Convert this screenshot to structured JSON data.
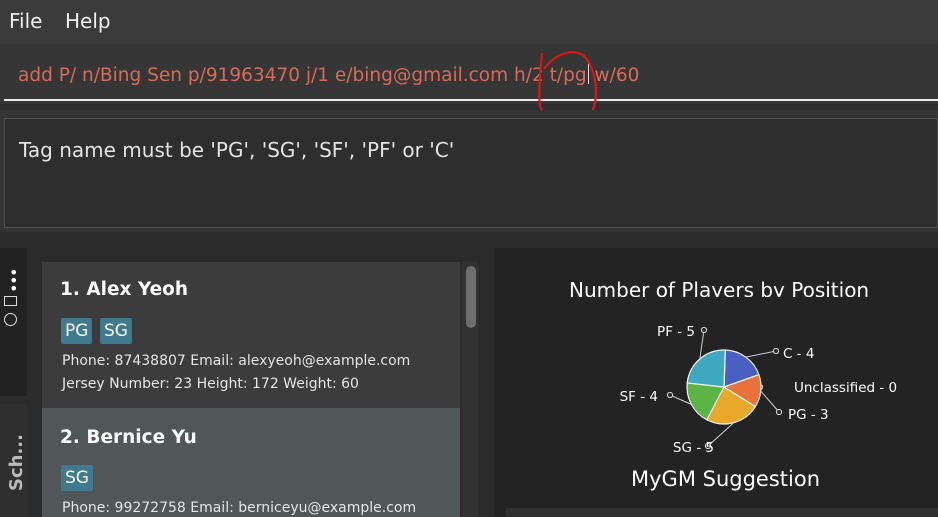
{
  "menu": {
    "file": "File",
    "help": "Help"
  },
  "command": {
    "text": "add P/ n/Bing Sen p/91963470 j/1 e/bing@gmail.com h/2 t/pg",
    "text_after_caret": " w/60"
  },
  "result": {
    "message": "Tag name must be 'PG', 'SG', 'SF', 'PF' or 'C'"
  },
  "sidebar": {
    "tab_label": "Sch..."
  },
  "players": [
    {
      "name": "1.  Alex Yeoh",
      "tags": [
        "PG",
        "SG"
      ],
      "line1": "Phone: 87438807   Email: alexyeoh@example.com",
      "line2": "Jersey Number: 23   Height: 172   Weight: 60"
    },
    {
      "name": "2.  Bernice Yu",
      "tags": [
        "SG"
      ],
      "line1": "Phone: 99272758   Email: berniceyu@example.com"
    }
  ],
  "chart_data": {
    "type": "pie",
    "title": "Number of Players by Position",
    "slices": [
      {
        "label": "C - 4",
        "value": 4,
        "color": "#4a5fc1"
      },
      {
        "label": "Unclassified - 0",
        "value": 0,
        "color": "#e0e0e0"
      },
      {
        "label": "PG - 3",
        "value": 3,
        "color": "#e8723a"
      },
      {
        "label": "SG - 5",
        "value": 5,
        "color": "#e9a82a"
      },
      {
        "label": "SF - 4",
        "value": 4,
        "color": "#5bb443"
      },
      {
        "label": "PF - 5",
        "value": 5,
        "color": "#3ea8c0"
      }
    ]
  },
  "suggestion": {
    "title": "MyGM Suggestion"
  }
}
